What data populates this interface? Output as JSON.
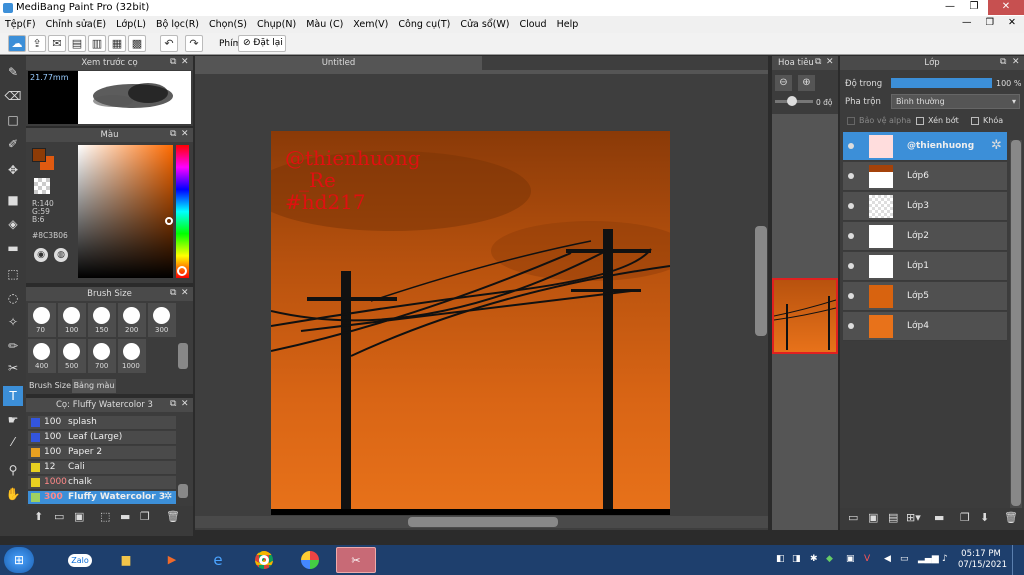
{
  "app": {
    "title": "MediBang Paint Pro (32bit)"
  },
  "menu": [
    "Tệp(F)",
    "Chỉnh sửa(E)",
    "Lớp(L)",
    "Bộ lọc(R)",
    "Chọn(S)",
    "Chụp(N)",
    "Màu (C)",
    "Xem(V)",
    "Công cụ(T)",
    "Cửa sổ(W)",
    "Cloud",
    "Help"
  ],
  "toolbar": {
    "key_label": "Phím",
    "reset_label": "Đặt lại"
  },
  "preview": {
    "title": "Xem trước cọ",
    "size": "21.77mm"
  },
  "color_panel": {
    "title": "Màu",
    "r": "R:140",
    "g": "G:59",
    "b": "B:6",
    "hex": "#8C3B06",
    "main_color": "#8C3B06"
  },
  "brush_size": {
    "title": "Brush Size",
    "sizes": [
      "70",
      "100",
      "150",
      "200",
      "300",
      "400",
      "500",
      "700",
      "1000"
    ],
    "tab1": "Brush Size",
    "tab2": "Bảng màu"
  },
  "brush_list": {
    "title": "Cọ: Fluffy Watercolor 3",
    "items": [
      {
        "size": "100",
        "name": "splash",
        "color": "#3355dd"
      },
      {
        "size": "100",
        "name": "Leaf (Large)",
        "color": "#3355dd"
      },
      {
        "size": "100",
        "name": "Paper 2",
        "color": "#e8a020"
      },
      {
        "size": "12",
        "name": "Cali",
        "color": "#e8d020"
      },
      {
        "size": "1000",
        "name": "chalk",
        "color": "#e8d020"
      },
      {
        "size": "300",
        "name": "Fluffy Watercolor 3",
        "color": "#a0d060"
      }
    ]
  },
  "canvas": {
    "tab": "Untitled",
    "overlay_lines": [
      "@thienhuong",
      "_Re",
      "#hd217"
    ]
  },
  "navigator": {
    "title": "Hoa tiêu",
    "angle": "0 độ"
  },
  "layers": {
    "title": "Lớp",
    "opacity_label": "Độ trong",
    "opacity_value": "100 %",
    "blend_label": "Pha trộn",
    "blend_value": "Bình thường",
    "opt_alpha": "Bảo vệ alpha",
    "opt_clip": "Xén bớt",
    "opt_lock": "Khóa",
    "items": [
      "@thienhuong",
      "Lớp6",
      "Lớp3",
      "Lớp2",
      "Lớp1",
      "Lớp5",
      "Lớp4"
    ]
  },
  "taskbar": {
    "time": "05:17 PM",
    "date": "07/15/2021",
    "zalo": "Zalo"
  }
}
